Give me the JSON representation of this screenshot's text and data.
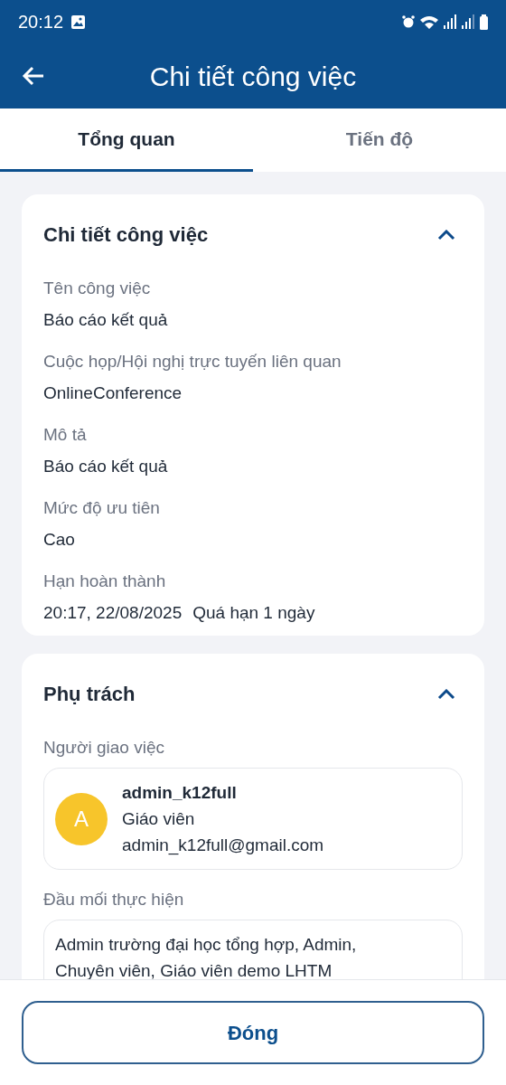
{
  "status_bar": {
    "time": "20:12"
  },
  "app_bar": {
    "title": "Chi tiết công việc"
  },
  "tabs": [
    {
      "label": "Tổng quan",
      "selected": true
    },
    {
      "label": "Tiến độ",
      "selected": false
    }
  ],
  "sections": [
    {
      "title": "Chi tiết công việc",
      "expanded": true,
      "fields": [
        {
          "kind": "text",
          "label": "Tên công việc",
          "value": "Báo cáo kết quả"
        },
        {
          "kind": "text",
          "label": "Cuộc họp/Hội nghị trực tuyến liên quan",
          "value": "OnlineConference"
        },
        {
          "kind": "text",
          "label": "Mô tả",
          "value": "Báo cáo kết quả"
        },
        {
          "kind": "text",
          "label": "Mức độ ưu tiên",
          "value": "Cao"
        },
        {
          "kind": "deadline",
          "label": "Hạn hoàn thành",
          "value": "20:17, 22/08/2025",
          "note": "Quá hạn 1 ngày"
        }
      ]
    },
    {
      "title": "Phụ trách",
      "expanded": true,
      "fields": [
        {
          "kind": "person",
          "label": "Người giao việc",
          "initial": "A",
          "name": "admin_k12full",
          "role": "Giáo viên",
          "email": "admin_k12full@gmail.com"
        },
        {
          "kind": "box",
          "label": "Đầu mối thực hiện",
          "value": "Admin trường đại học tổng hợp, Admin, Chuyên viên, Giáo viên demo LHTM"
        }
      ]
    }
  ],
  "footer": {
    "button": "Đóng"
  }
}
